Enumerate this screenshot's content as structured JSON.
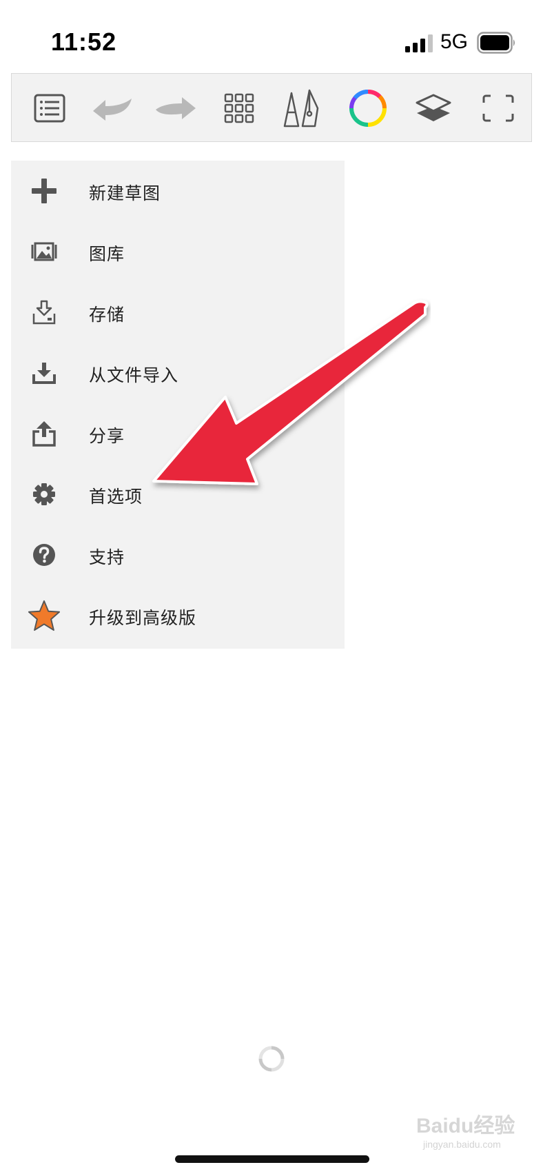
{
  "status_bar": {
    "time": "11:52",
    "network": "5G",
    "signal_icon": "cellular-signal-icon",
    "battery_icon": "battery-icon"
  },
  "toolbar": {
    "buttons": [
      {
        "icon": "list-menu-icon"
      },
      {
        "icon": "undo-icon"
      },
      {
        "icon": "redo-icon"
      },
      {
        "icon": "grid-icon"
      },
      {
        "icon": "brush-pen-icon"
      },
      {
        "icon": "color-wheel-icon"
      },
      {
        "icon": "layers-icon"
      },
      {
        "icon": "fullscreen-icon"
      }
    ],
    "disabled_color": "#b8b8b8",
    "icon_color": "#555555"
  },
  "menu": {
    "items": [
      {
        "label": "新建草图",
        "icon": "plus-icon"
      },
      {
        "label": "图库",
        "icon": "gallery-icon"
      },
      {
        "label": "存储",
        "icon": "save-icon"
      },
      {
        "label": "从文件导入",
        "icon": "import-icon"
      },
      {
        "label": "分享",
        "icon": "share-icon"
      },
      {
        "label": "首选项",
        "icon": "gear-icon"
      },
      {
        "label": "支持",
        "icon": "help-icon"
      },
      {
        "label": "升级到高级版",
        "icon": "star-icon"
      }
    ],
    "star_color": "#f07a2a"
  },
  "annotation": {
    "arrow_color": "#e8283a"
  },
  "watermark": {
    "text": "Baidu经验",
    "url": "jingyan.baidu.com"
  }
}
